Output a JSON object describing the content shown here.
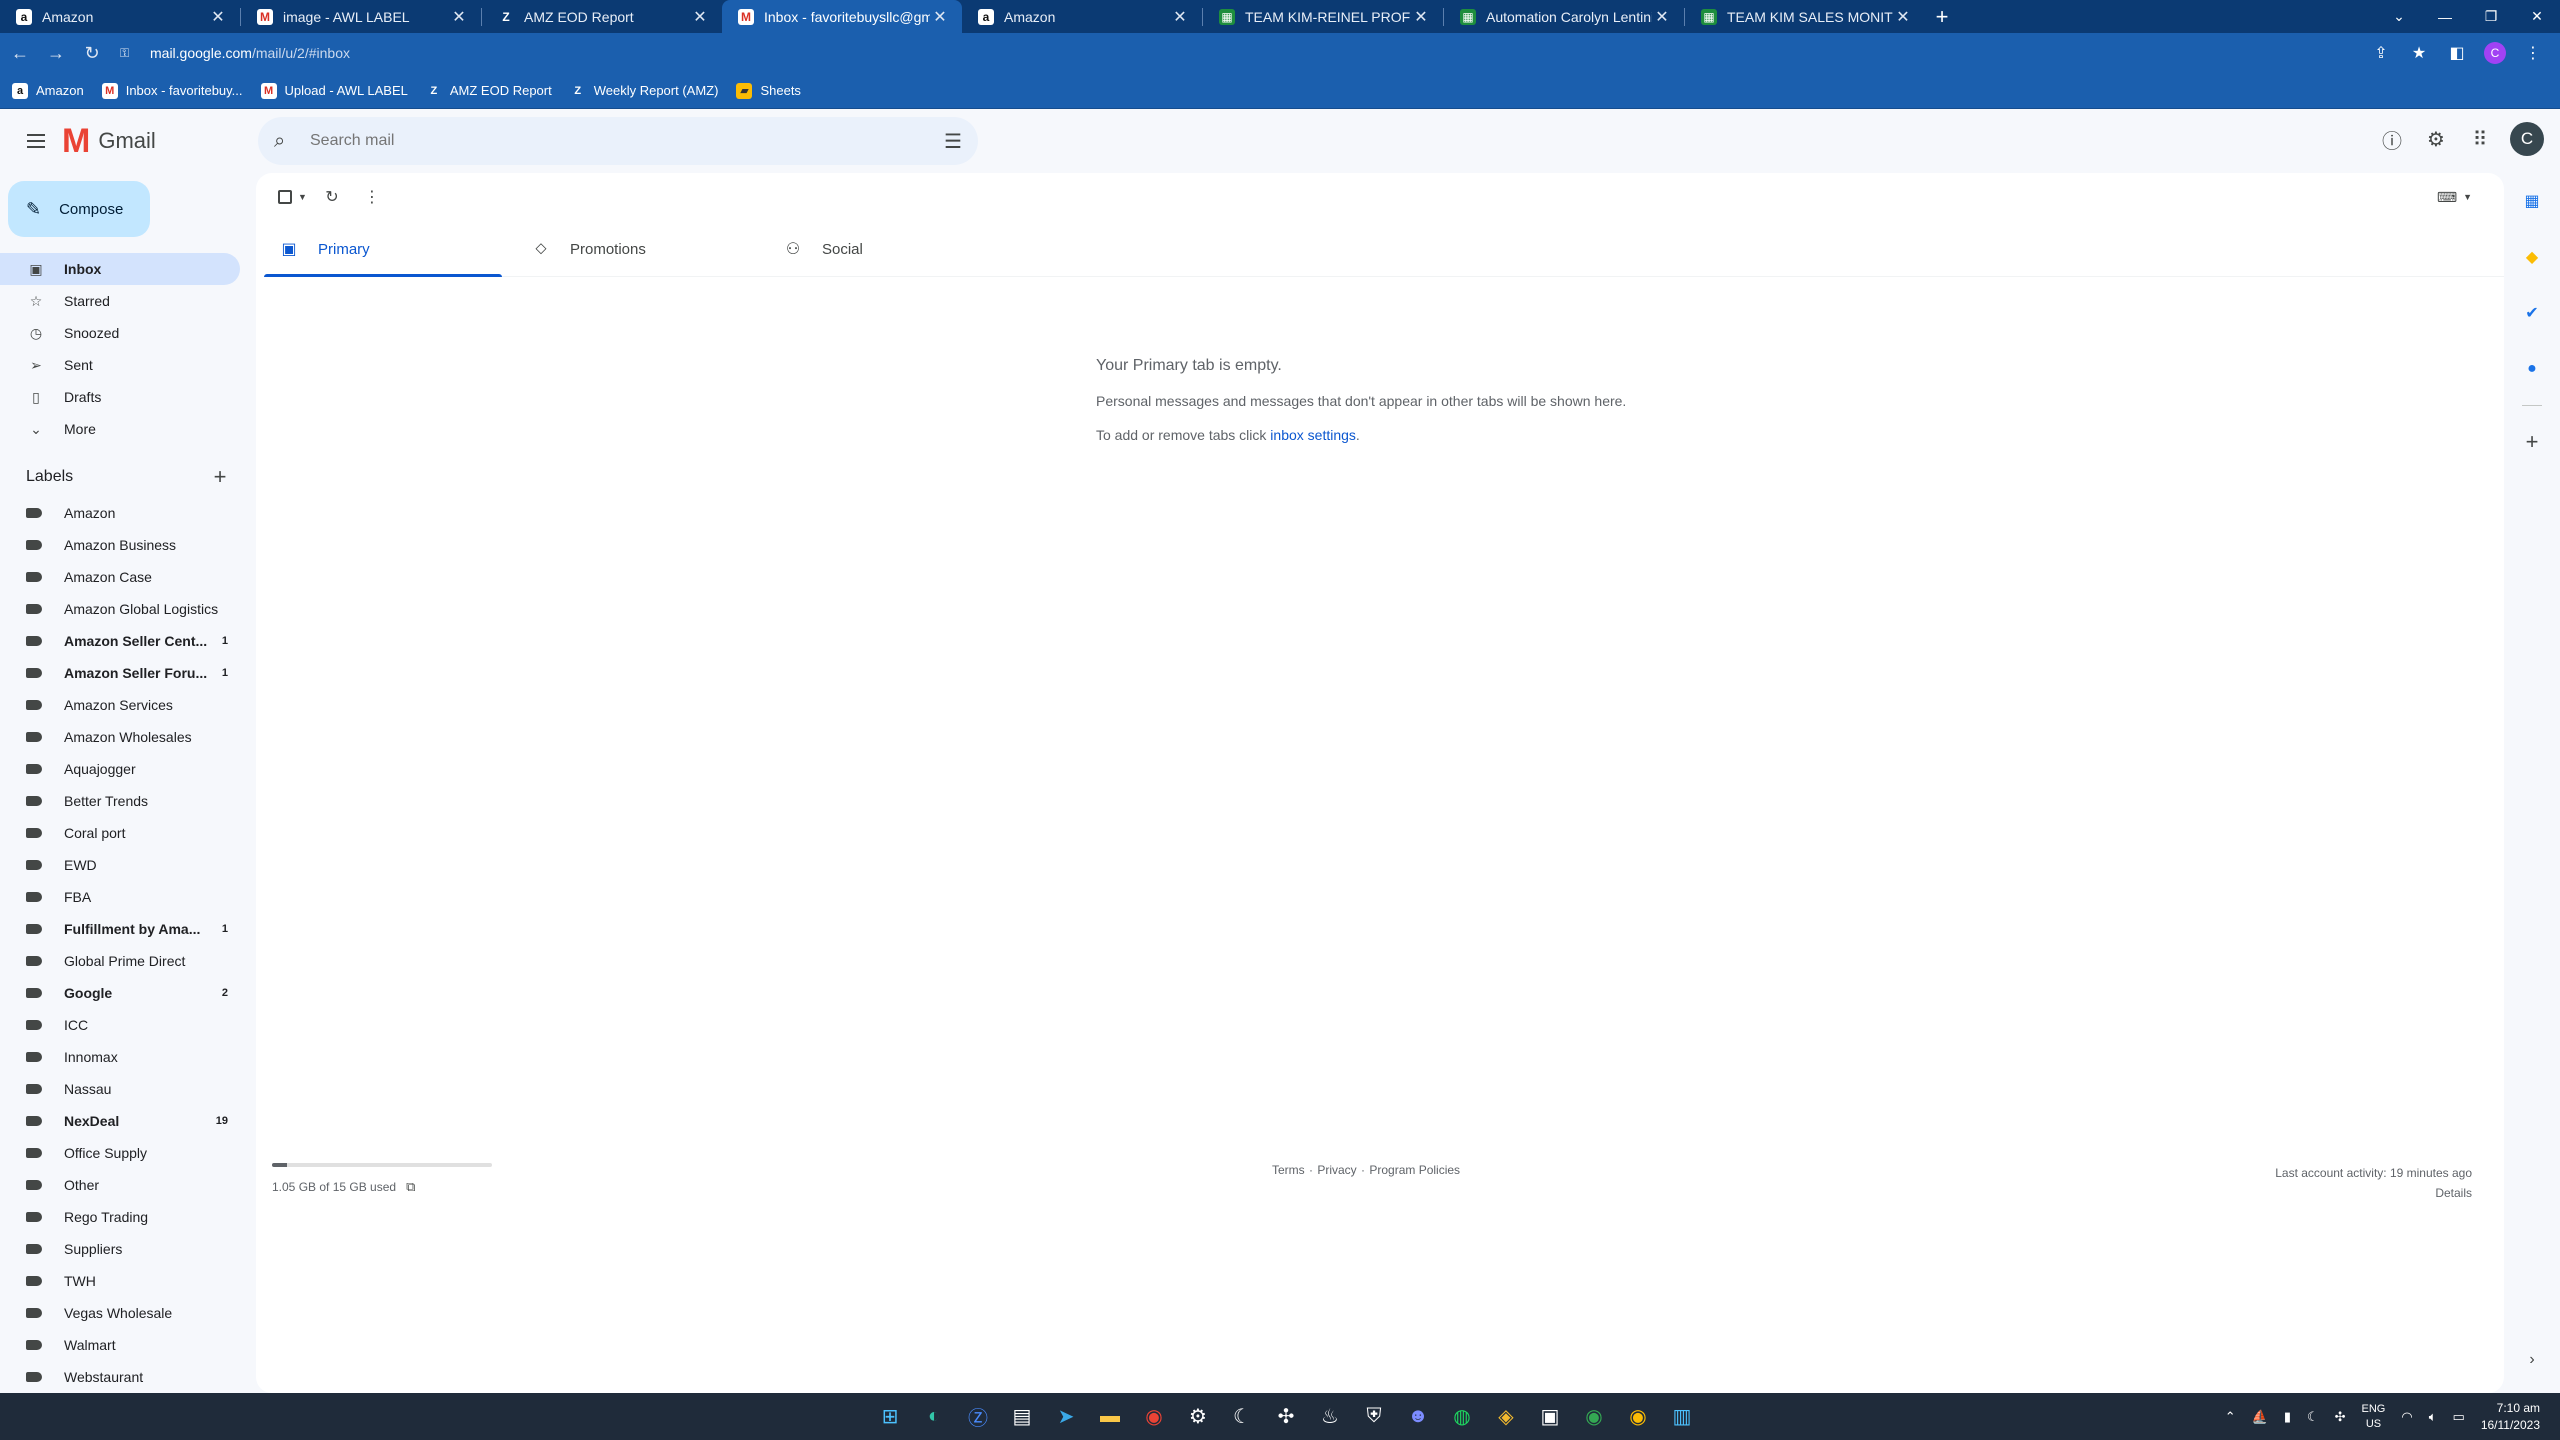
{
  "browser": {
    "tabs": [
      {
        "title": "Amazon",
        "favicon": "a"
      },
      {
        "title": "image - AWL LABEL",
        "favicon": "M"
      },
      {
        "title": "AMZ EOD Report",
        "favicon": "Z"
      },
      {
        "title": "Inbox - favoritebuysllc@gmail.c",
        "favicon": "M"
      },
      {
        "title": "Amazon",
        "favicon": "a"
      },
      {
        "title": "TEAM KIM-REINEL PROFIT SHEE",
        "favicon": "sheet"
      },
      {
        "title": "Automation Carolyn Lentini Tea",
        "favicon": "sheet"
      },
      {
        "title": "TEAM KIM SALES MONITORING",
        "favicon": "sheet"
      }
    ],
    "url_host": "mail.google.com",
    "url_path": "/mail/u/2/#inbox",
    "profile_initial": "C",
    "bookmarks": [
      {
        "label": "Amazon",
        "favicon": "a"
      },
      {
        "label": "Inbox - favoritebuy...",
        "favicon": "M"
      },
      {
        "label": "Upload - AWL LABEL",
        "favicon": "M"
      },
      {
        "label": "AMZ EOD Report",
        "favicon": "Z"
      },
      {
        "label": "Weekly Report (AMZ)",
        "favicon": "Z"
      },
      {
        "label": "Sheets",
        "favicon": "folder"
      }
    ]
  },
  "gmail": {
    "product_name": "Gmail",
    "search_placeholder": "Search mail",
    "avatar_initial": "C",
    "compose_label": "Compose",
    "nav": [
      {
        "label": "Inbox",
        "icon": "inbox-icon",
        "glyph": "▣"
      },
      {
        "label": "Starred",
        "icon": "star-icon",
        "glyph": "☆"
      },
      {
        "label": "Snoozed",
        "icon": "clock-icon",
        "glyph": "◷"
      },
      {
        "label": "Sent",
        "icon": "send-icon",
        "glyph": "➢"
      },
      {
        "label": "Drafts",
        "icon": "draft-icon",
        "glyph": "▯"
      },
      {
        "label": "More",
        "icon": "chevron-down-icon",
        "glyph": "⌄"
      }
    ],
    "labels_heading": "Labels",
    "labels": [
      {
        "name": "Amazon",
        "count": ""
      },
      {
        "name": "Amazon Business",
        "count": ""
      },
      {
        "name": "Amazon Case",
        "count": ""
      },
      {
        "name": "Amazon Global Logistics",
        "count": ""
      },
      {
        "name": "Amazon Seller Cent...",
        "count": "1"
      },
      {
        "name": "Amazon Seller Foru...",
        "count": "1"
      },
      {
        "name": "Amazon Services",
        "count": ""
      },
      {
        "name": "Amazon Wholesales",
        "count": ""
      },
      {
        "name": "Aquajogger",
        "count": ""
      },
      {
        "name": "Better Trends",
        "count": ""
      },
      {
        "name": "Coral port",
        "count": ""
      },
      {
        "name": "EWD",
        "count": ""
      },
      {
        "name": "FBA",
        "count": ""
      },
      {
        "name": "Fulfillment by Ama...",
        "count": "1"
      },
      {
        "name": "Global Prime Direct",
        "count": ""
      },
      {
        "name": "Google",
        "count": "2"
      },
      {
        "name": "ICC",
        "count": ""
      },
      {
        "name": "Innomax",
        "count": ""
      },
      {
        "name": "Nassau",
        "count": ""
      },
      {
        "name": "NexDeal",
        "count": "19"
      },
      {
        "name": "Office Supply",
        "count": ""
      },
      {
        "name": "Other",
        "count": ""
      },
      {
        "name": "Rego Trading",
        "count": ""
      },
      {
        "name": "Suppliers",
        "count": ""
      },
      {
        "name": "TWH",
        "count": ""
      },
      {
        "name": "Vegas Wholesale",
        "count": ""
      },
      {
        "name": "Walmart",
        "count": ""
      },
      {
        "name": "Webstaurant",
        "count": ""
      }
    ],
    "inbox_tabs": [
      {
        "label": "Primary",
        "icon": "inbox-icon",
        "glyph": "▣"
      },
      {
        "label": "Promotions",
        "icon": "tag-icon",
        "glyph": "⬦"
      },
      {
        "label": "Social",
        "icon": "people-icon",
        "glyph": "⚇"
      }
    ],
    "empty_heading": "Your Primary tab is empty.",
    "empty_text": "Personal messages and messages that don't appear in other tabs will be shown here.",
    "empty_settings_prefix": "To add or remove tabs click ",
    "empty_settings_link": "inbox settings",
    "empty_settings_suffix": ".",
    "storage_text": "1.05 GB of 15 GB used",
    "storage_fraction": 0.07,
    "footer_terms": "Terms",
    "footer_privacy": "Privacy",
    "footer_policies": "Program Policies",
    "footer_sep": " · ",
    "last_activity": "Last account activity: 19 minutes ago",
    "details_link": "Details"
  },
  "taskbar": {
    "lang_top": "ENG",
    "lang_bottom": "US",
    "time": "7:10 am",
    "date": "16/11/2023"
  }
}
